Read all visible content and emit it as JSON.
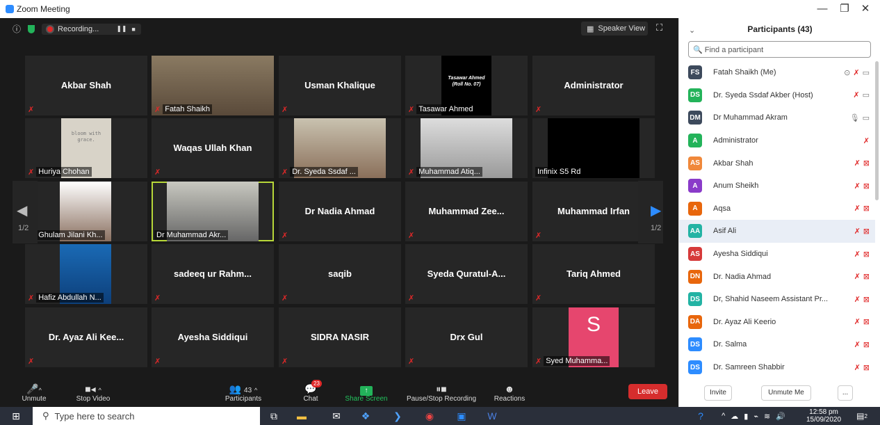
{
  "window": {
    "title": "Zoom Meeting",
    "min": "—",
    "max": "❐",
    "close": "✕"
  },
  "topbar": {
    "recording": "Recording...",
    "pause": "❚❚",
    "stop": "■",
    "speaker_view": "Speaker View"
  },
  "grid": {
    "page_left": "1/2",
    "page_right": "1/2",
    "tiles": [
      {
        "name": "Akbar Shah",
        "label": "",
        "video": false
      },
      {
        "name": "",
        "label": "Fatah Shaikh",
        "video": true
      },
      {
        "name": "Usman Khalique",
        "label": "",
        "video": false
      },
      {
        "name": "",
        "label": "Tasawar Ahmed",
        "video": true,
        "card_line1": "Tasawar Ahmed",
        "card_line2": "(Roll No. 07)"
      },
      {
        "name": "Administrator",
        "label": "",
        "video": false
      },
      {
        "name": "",
        "label": "Huriya Chohan",
        "video": true,
        "card_text": "bloom with grace."
      },
      {
        "name": "Waqas Ullah Khan",
        "label": "",
        "video": false
      },
      {
        "name": "",
        "label": "Dr. Syeda Ssdaf ...",
        "video": true
      },
      {
        "name": "",
        "label": "Muhammad Atiq...",
        "video": true
      },
      {
        "name": "",
        "label": "Infinix S5 Rd",
        "video": true,
        "muted": false
      },
      {
        "name": "",
        "label": "Ghulam Jilani Kh...",
        "video": true
      },
      {
        "name": "",
        "label": "Dr Muhammad Akr...",
        "video": true,
        "muted": false,
        "active": true
      },
      {
        "name": "Dr  Nadia Ahmad",
        "label": "",
        "video": false
      },
      {
        "name": "Muhammad  Zee...",
        "label": "",
        "video": false
      },
      {
        "name": "Muhammad Irfan",
        "label": "",
        "video": false
      },
      {
        "name": "",
        "label": "Hafiz Abdullah N...",
        "video": true
      },
      {
        "name": "sadeeq ur Rahm...",
        "label": "",
        "video": false
      },
      {
        "name": "saqib",
        "label": "",
        "video": false
      },
      {
        "name": "Syeda  Quratul-A...",
        "label": "",
        "video": false
      },
      {
        "name": "Tariq Ahmed",
        "label": "",
        "video": false
      },
      {
        "name": "Dr. Ayaz Ali Kee...",
        "label": "",
        "video": false
      },
      {
        "name": "Ayesha Siddiqui",
        "label": "",
        "video": false
      },
      {
        "name": "SIDRA NASIR",
        "label": "",
        "video": false
      },
      {
        "name": "Drx Gul",
        "label": "",
        "video": false
      },
      {
        "name": "",
        "label": "Syed Muhamma...",
        "video": true,
        "avatar_letter": "S"
      }
    ]
  },
  "toolbar": {
    "unmute": "Unmute",
    "stop_video": "Stop Video",
    "participants": "Participants",
    "participants_count": "43",
    "chat": "Chat",
    "chat_badge": "23",
    "share_screen": "Share Screen",
    "pause_stop": "Pause/Stop Recording",
    "reactions": "Reactions",
    "leave": "Leave"
  },
  "panel": {
    "title": "Participants (43)",
    "search_placeholder": "Find a participant",
    "invite": "Invite",
    "unmute_me": "Unmute Me",
    "more": "...",
    "participants": [
      {
        "initials": "FS",
        "name": "Fatah Shaikh (Me)",
        "color": "#3d4a5c",
        "icons": "rec"
      },
      {
        "initials": "DS",
        "name": "Dr. Syeda Ssdaf Akber (Host)",
        "color": "#23b35a",
        "icons": "mutecam"
      },
      {
        "initials": "DM",
        "name": "Dr Muhammad Akram",
        "color": "#3d4a5c",
        "icons": "live"
      },
      {
        "initials": "A",
        "name": "Administrator",
        "color": "#23b35a",
        "icons": "muteonly"
      },
      {
        "initials": "AS",
        "name": "Akbar Shah",
        "color": "#f0883a",
        "icons": "off"
      },
      {
        "initials": "A",
        "name": "Anum Sheikh",
        "color": "#8a3bc9",
        "icons": "off"
      },
      {
        "initials": "A",
        "name": "Aqsa",
        "color": "#e8660c",
        "icons": "off"
      },
      {
        "initials": "AA",
        "name": "Asif Ali",
        "color": "#23b3a4",
        "icons": "off"
      },
      {
        "initials": "AS",
        "name": "Ayesha Siddiqui",
        "color": "#d63a3a",
        "icons": "off"
      },
      {
        "initials": "DN",
        "name": "Dr. Nadia Ahmad",
        "color": "#e8660c",
        "icons": "off"
      },
      {
        "initials": "DS",
        "name": "Dr, Shahid Naseem Assistant Pr...",
        "color": "#23b3a4",
        "icons": "off"
      },
      {
        "initials": "DA",
        "name": "Dr. Ayaz Ali Keerio",
        "color": "#e8660c",
        "icons": "off"
      },
      {
        "initials": "DS",
        "name": "Dr. Salma",
        "color": "#2d8cff",
        "icons": "off"
      },
      {
        "initials": "DS",
        "name": "Dr. Samreen Shabbir",
        "color": "#2d8cff",
        "icons": "off"
      }
    ]
  },
  "taskbar": {
    "search": "Type here to search",
    "time": "12:58 pm",
    "date": "15/09/2020",
    "notifications": "2"
  }
}
